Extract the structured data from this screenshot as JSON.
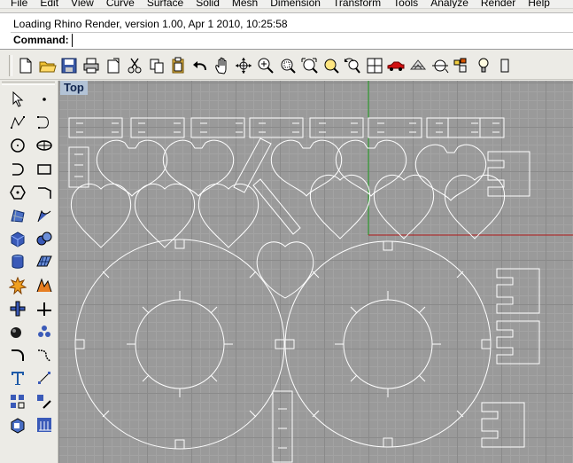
{
  "menu": [
    "File",
    "Edit",
    "View",
    "Curve",
    "Surface",
    "Solid",
    "Mesh",
    "Dimension",
    "Transform",
    "Tools",
    "Analyze",
    "Render",
    "Help"
  ],
  "command": {
    "history": "Loading Rhino Render, version 1.00, Apr  1 2010, 10:25:58",
    "label": "Command:",
    "value": ""
  },
  "toolbar_icons": [
    "new-icon",
    "open-icon",
    "save-icon",
    "print-icon",
    "import-icon",
    "cut-icon",
    "copy-icon",
    "paste-icon",
    "undo-icon",
    "pan-icon",
    "rotate-view-icon",
    "zoom-icon",
    "zoom-window-icon",
    "zoom-extents-icon",
    "zoom-selected-icon",
    "undo-view-icon",
    "four-viewports-icon",
    "car-render-icon",
    "render-mesh-icon",
    "osnap-icon",
    "layer-icon",
    "light-bulb-icon",
    "more-icon"
  ],
  "sidebar_left_icons": [
    "select-arrow-icon",
    "polyline-icon",
    "circle-icon",
    "arc-icon",
    "polygon-icon",
    "surface-icon",
    "box-solid-icon",
    "cylinder-icon",
    "explode-icon",
    "boolean-union-icon",
    "solid-tools-icon",
    "fillet-icon",
    "text-icon",
    "array-icon",
    "block-icon"
  ],
  "sidebar_right_icons": [
    "point-icon",
    "curve-icon",
    "ellipse-icon",
    "rectangle-icon",
    "free-curve-icon",
    "rebuild-icon",
    "sphere-icon",
    "plane-icon",
    "boolean-split-icon",
    "trim-icon",
    "group-icon",
    "blend-icon",
    "dimension-icon",
    "transform-icon",
    "grid-snap-icon"
  ],
  "viewport": {
    "label": "Top",
    "colors": {
      "background": "#9a9a9a",
      "curve": "#ffffff",
      "y_axis": "#20a020",
      "x_axis": "#b01818",
      "label_bg": "#b3c3d6"
    }
  }
}
